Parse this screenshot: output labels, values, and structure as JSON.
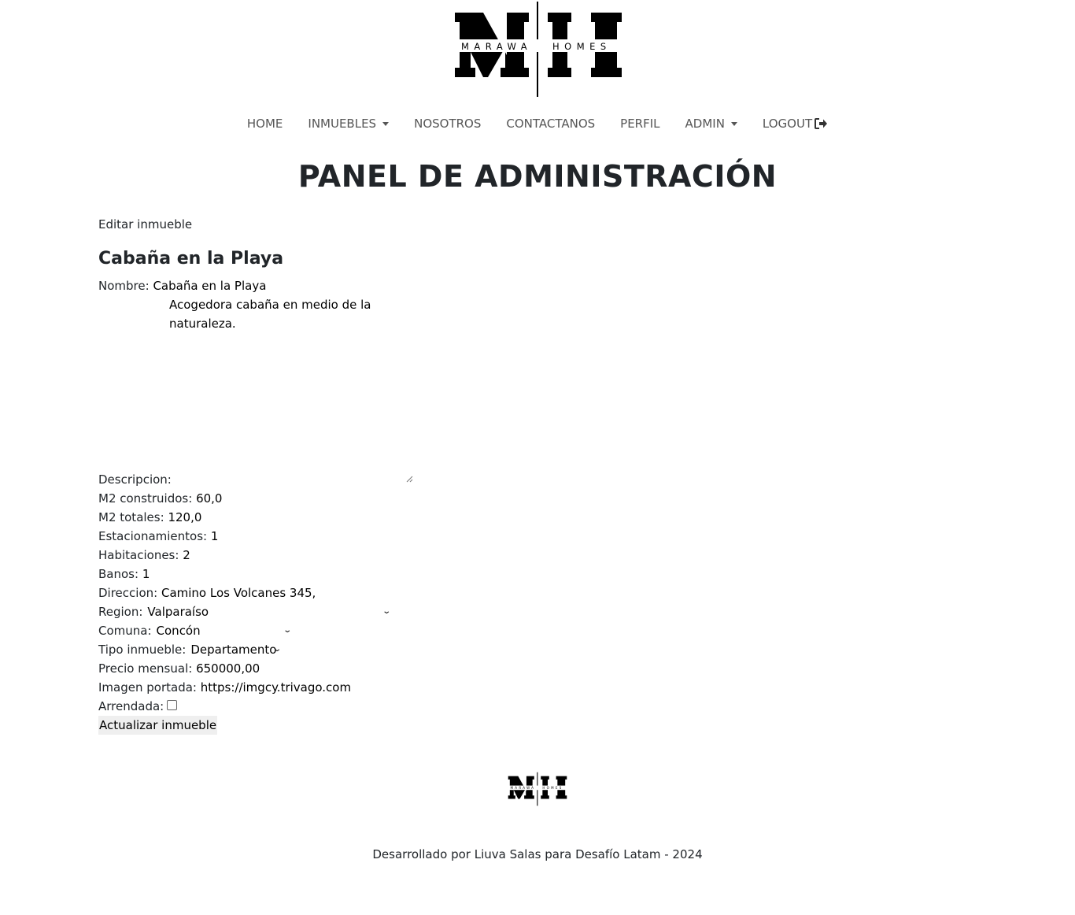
{
  "brand": {
    "logo_letters": "MH",
    "logo_name": "MARAWA HOMES"
  },
  "nav": {
    "items": [
      {
        "label": "HOME",
        "dropdown": false
      },
      {
        "label": "INMUEBLES",
        "dropdown": true
      },
      {
        "label": "NOSOTROS",
        "dropdown": false
      },
      {
        "label": "CONTACTANOS",
        "dropdown": false
      },
      {
        "label": "PERFIL",
        "dropdown": false
      },
      {
        "label": "ADMIN",
        "dropdown": true
      },
      {
        "label": "LOGOUT",
        "dropdown": false,
        "icon": "logout-icon"
      }
    ]
  },
  "page": {
    "title": "PANEL DE ADMINISTRACIÓN",
    "subtitle": "Editar inmueble",
    "property_name": "Cabaña en la Playa"
  },
  "form": {
    "nombre": {
      "label": "Nombre:",
      "value": "Cabaña en la Playa"
    },
    "descripcion": {
      "label": "Descripcion:",
      "value": "Acogedora cabaña en medio de la naturaleza."
    },
    "m2_construidos": {
      "label": "M2 construidos:",
      "value": "60,0"
    },
    "m2_totales": {
      "label": "M2 totales:",
      "value": "120,0"
    },
    "estacionamientos": {
      "label": "Estacionamientos:",
      "value": "1"
    },
    "habitaciones": {
      "label": "Habitaciones:",
      "value": "2"
    },
    "banos": {
      "label": "Banos:",
      "value": "1"
    },
    "direccion": {
      "label": "Direccion:",
      "value": "Camino Los Volcanes 345,"
    },
    "region": {
      "label": "Region:",
      "value": "Valparaíso"
    },
    "comuna": {
      "label": "Comuna:",
      "value": "Concón"
    },
    "tipo_inmueble": {
      "label": "Tipo inmueble:",
      "value": "Departamento"
    },
    "precio_mensual": {
      "label": "Precio mensual:",
      "value": "650000,00"
    },
    "imagen_portada": {
      "label": "Imagen portada:",
      "value": "https://imgcy.trivago.com"
    },
    "arrendada": {
      "label": "Arrendada:",
      "checked": false
    },
    "submit_label": "Actualizar inmueble"
  },
  "footer": {
    "text": "Desarrollado por Liuva Salas para Desafío Latam - 2024"
  }
}
